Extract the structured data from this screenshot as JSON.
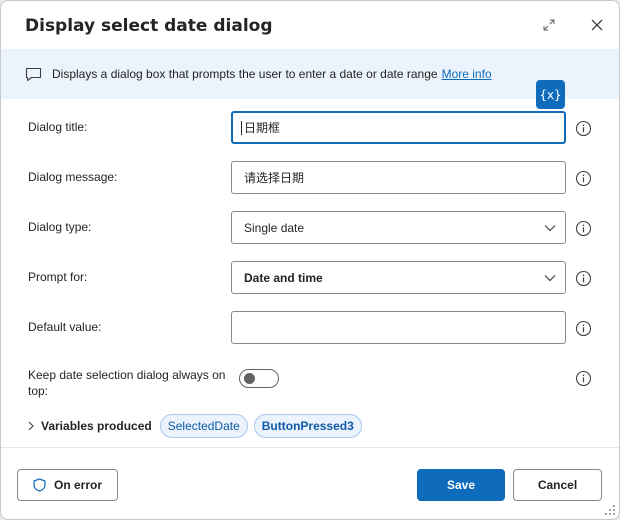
{
  "dialog": {
    "title": "Display select date dialog"
  },
  "banner": {
    "text": "Displays a dialog box that prompts the user to enter a date or date range",
    "link": "More info"
  },
  "variable_button": {
    "label": "{x}"
  },
  "fields": {
    "dialog_title": {
      "label": "Dialog title:",
      "value": "日期框"
    },
    "dialog_message": {
      "label": "Dialog message:",
      "value": "请选择日期"
    },
    "dialog_type": {
      "label": "Dialog type:",
      "value": "Single date"
    },
    "prompt_for": {
      "label": "Prompt for:",
      "value": "Date and time"
    },
    "default_value": {
      "label": "Default value:",
      "value": ""
    },
    "keep_on_top": {
      "label_line1": "Keep date selection dialog always on",
      "label_line2": "top:",
      "enabled": false
    }
  },
  "variables": {
    "label": "Variables produced",
    "items": [
      "SelectedDate",
      "ButtonPressed3"
    ]
  },
  "footer": {
    "on_error": "On error",
    "save": "Save",
    "cancel": "Cancel"
  },
  "colors": {
    "accent": "#0f6cbd",
    "banner_bg": "#ebf3fc",
    "chip_bg": "#ebf3fc"
  },
  "icons": [
    "expand-icon",
    "close-icon",
    "message-icon",
    "info-icon",
    "chevron-down-icon",
    "chevron-right-icon",
    "shield-icon",
    "resize-grip-icon"
  ]
}
